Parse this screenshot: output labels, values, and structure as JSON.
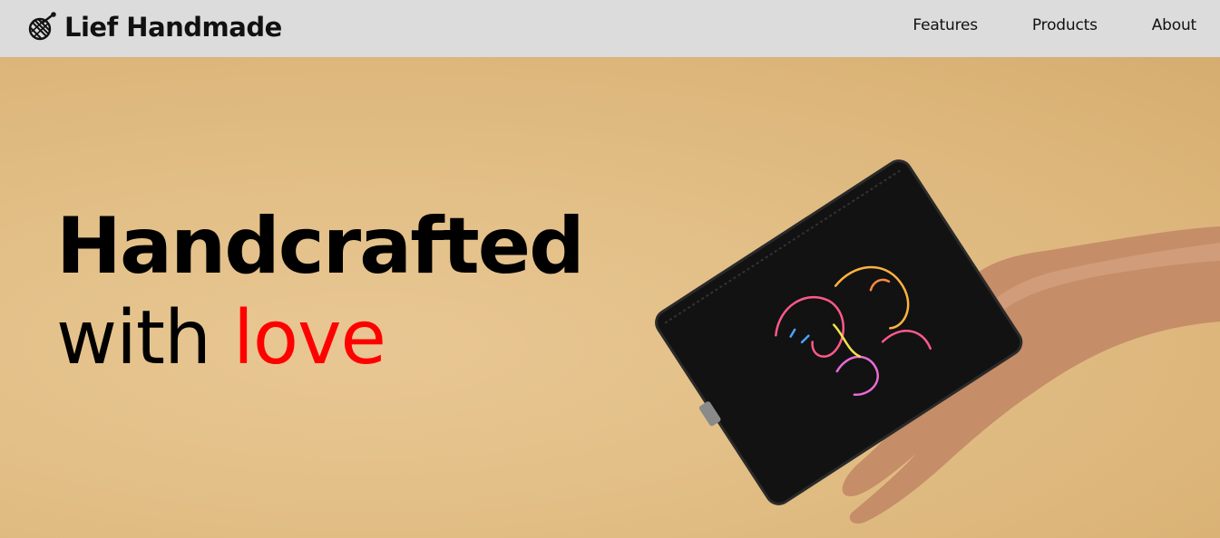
{
  "brand": {
    "name": "Lief Handmade",
    "icon": "yarn-needle-icon"
  },
  "nav": {
    "items": [
      {
        "label": "Features"
      },
      {
        "label": "Products"
      },
      {
        "label": "About"
      }
    ]
  },
  "hero": {
    "line1": "Handcrafted",
    "line2_prefix": "with ",
    "line2_accent": "love",
    "accent_color": "#ff0000",
    "background_color": "#e2bf86",
    "image": "black-embroidered-pouch-held-by-hand"
  }
}
